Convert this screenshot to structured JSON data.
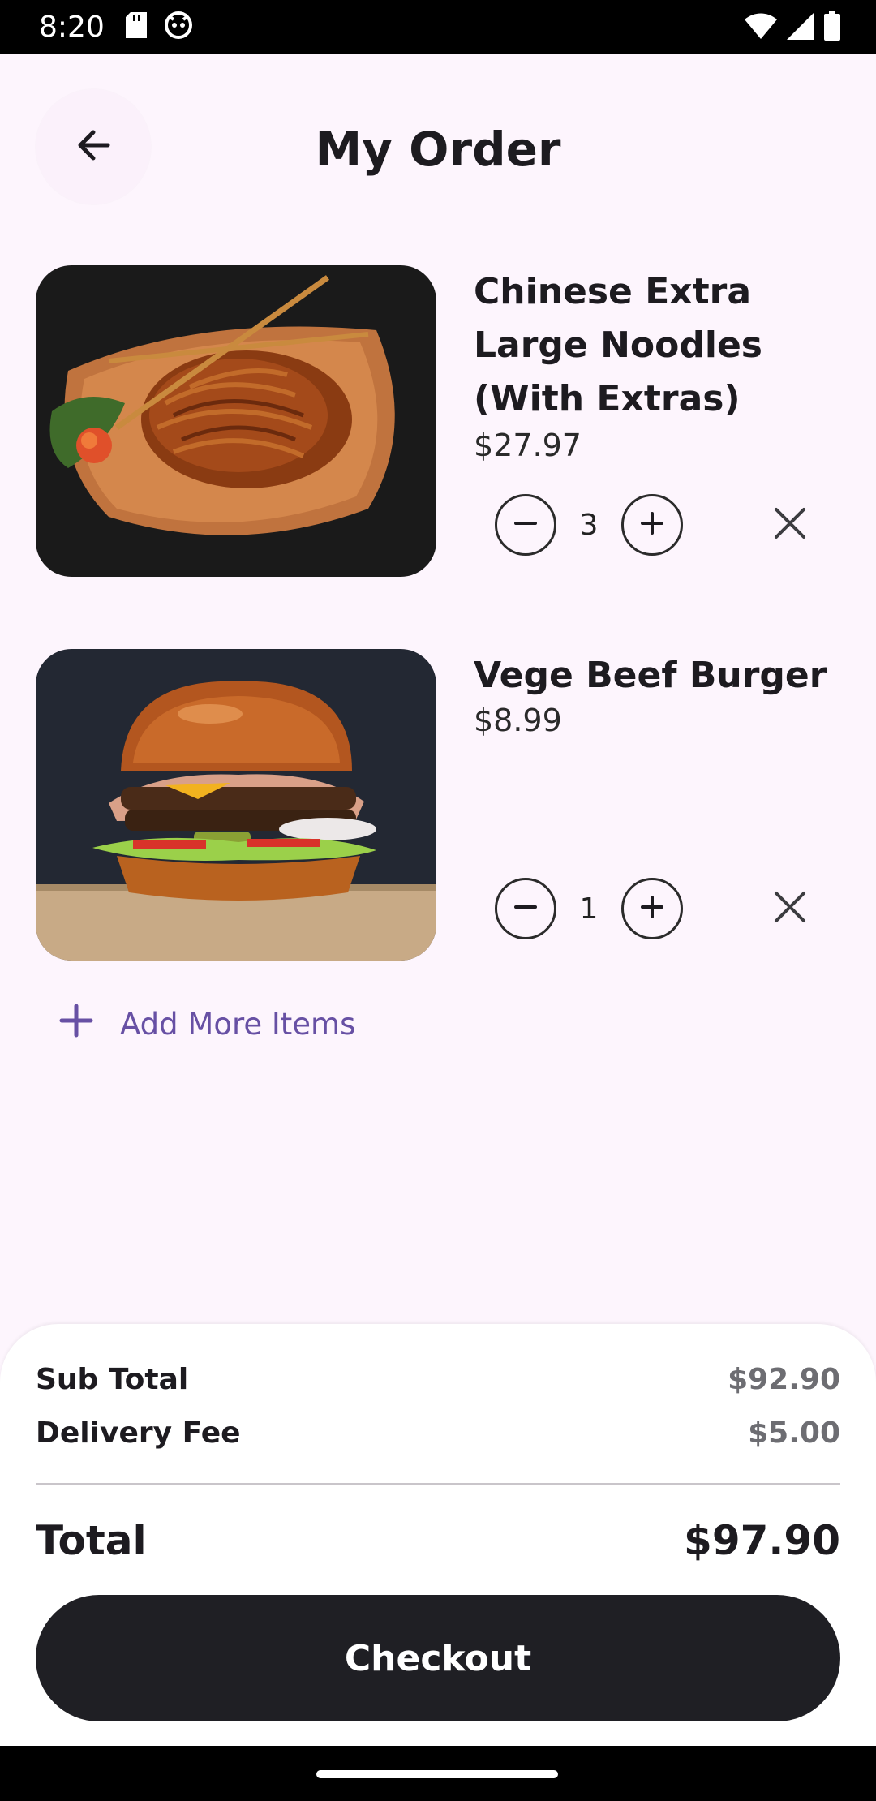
{
  "status_bar": {
    "time": "8:20",
    "left_icons": [
      "sd-card-icon",
      "notification-cat-icon"
    ],
    "right_icons": [
      "wifi-icon",
      "cellular-signal-icon",
      "battery-icon"
    ]
  },
  "header": {
    "title": "My Order",
    "back_icon": "arrow-back-icon"
  },
  "order_items": [
    {
      "name": "Chinese Extra Large Noodles (With Extras)",
      "price": "$27.97",
      "quantity": "3",
      "image": "noodles-photo"
    },
    {
      "name": "Vege Beef Burger",
      "price": "$8.99",
      "quantity": "1",
      "image": "burger-photo"
    }
  ],
  "add_more": {
    "label": "Add More Items",
    "icon": "plus-icon"
  },
  "summary": {
    "sub_total_label": "Sub Total",
    "sub_total_value": "$92.90",
    "delivery_fee_label": "Delivery Fee",
    "delivery_fee_value": "$5.00",
    "total_label": "Total",
    "total_value": "$97.90",
    "checkout_label": "Checkout"
  },
  "colors": {
    "background": "#fdf5fd",
    "accent": "#6750a4",
    "checkout_button": "#1f1f24"
  }
}
